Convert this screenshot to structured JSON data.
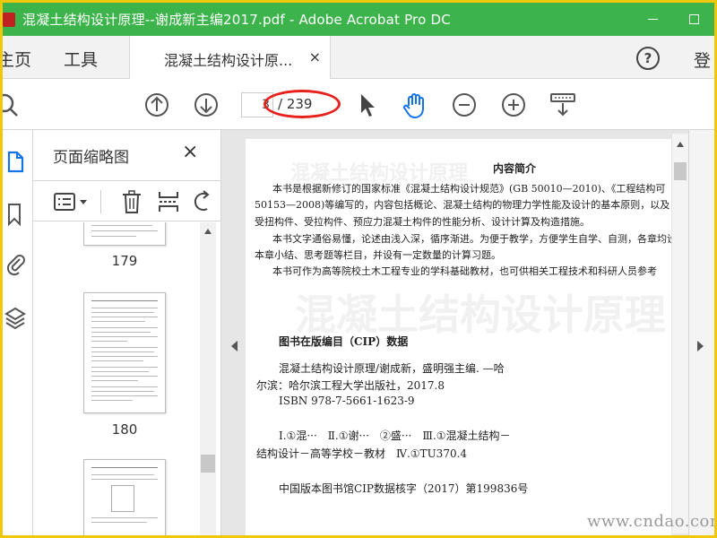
{
  "window": {
    "title": "混凝土结构设计原理--谢成新主编2017.pdf - Adobe Acrobat Pro DC"
  },
  "tabs": {
    "home": "主页",
    "tools": "工具",
    "doc": "混凝土结构设计原...",
    "close": "×",
    "signin": "登"
  },
  "toolbar": {
    "page_current": "3",
    "page_total": "/ 239"
  },
  "panel": {
    "title": "页面缩略图",
    "close": "×",
    "thumbs": [
      {
        "label": "179"
      },
      {
        "label": "180"
      }
    ]
  },
  "page": {
    "heading": "内容简介",
    "intro_lines": [
      "本书是根据新修订的国家标准《混凝土结构设计规范》(GB 50010—2010)、《工程结构可",
      "50153—2008)等编写的，内容包括概论、混凝土结构的物理力学性能及设计的基本原则，以及",
      "受扭构件、受拉构件、预应力混凝土构件的性能分析、设计计算及构造措施。",
      "本书文字通俗易懂，论述由浅入深，循序渐进。为便于教学，方便学生自学、自测，各章均设",
      "本章小结、思考题等栏目，并设有一定数量的计算习题。",
      "本书可作为高等院校土木工程专业的学科基础教材，也可供相关工程技术和科研人员参考"
    ],
    "cip_title": "图书在版编目（CIP）数据",
    "cip_lines": [
      "混凝土结构设计原理/谢成新，盛明强主编. —哈",
      "尔滨：哈尔滨工程大学出版社，2017.8",
      "ISBN 978-7-5661-1623-9"
    ],
    "class_lines": [
      "Ⅰ.①混···　Ⅱ.①谢···　②盛···　Ⅲ.①混凝土结构－",
      "结构设计－高等学校－教材　Ⅳ.①TU370.4"
    ],
    "cip_number": "中国版本图书馆CIP数据核字（2017）第199836号",
    "ghost_title": "混凝土结构设计原理"
  },
  "watermark": "www.cndao.com",
  "colors": {
    "titlebar": "#3cb44b",
    "frame": "#f0c808",
    "annotation": "#e8201c",
    "icon_blue": "#1473e6"
  }
}
